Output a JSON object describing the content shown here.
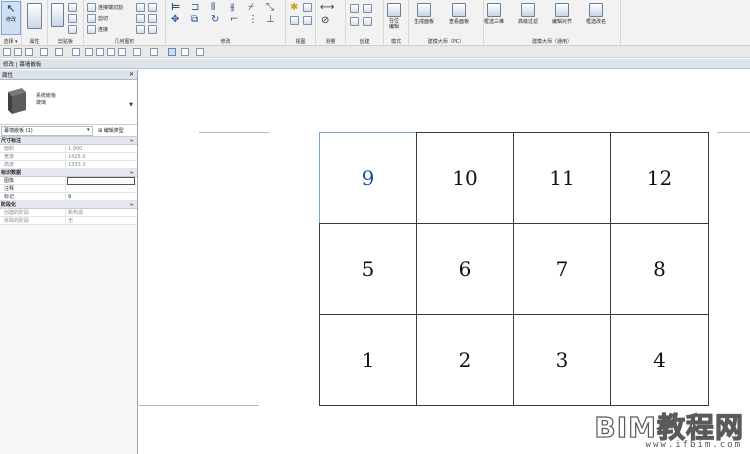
{
  "ribbon": {
    "modify_label": "修改",
    "select_label": "选择 ▾",
    "panels": {
      "properties": "属性",
      "clipboard": "剪贴板",
      "geometry": "几何图形",
      "modify": "修改",
      "view": "视图",
      "measure": "测量",
      "create": "创建",
      "mode": "模式",
      "model_pc": "建模大师（PC）",
      "model_general": "建模大师（通用）"
    },
    "geometry_items": [
      "连接端切割",
      "剪切",
      "连接"
    ],
    "buttons": {
      "in_place_edit": "在位\n编辑",
      "generate_panel": "生成面板",
      "view_panel": "查看面板",
      "filter_3d": "框选三维",
      "advanced_filter": "高级过滤",
      "unpin_all": "编辑对齐",
      "filter_revise": "框选改名"
    }
  },
  "context_bar": {
    "text": "修改 | 幕墙嵌板"
  },
  "properties": {
    "title": "属性",
    "close_glyph": "✕",
    "type_family": "系统嵌板",
    "type_name": "玻璃",
    "instance_selector": "幕墙嵌板 (1)",
    "edit_type": "编辑类型",
    "groups": [
      {
        "name": "尺寸标注",
        "rows": [
          {
            "key": "面积",
            "value": "1.900",
            "dim": true
          },
          {
            "key": "宽度",
            "value": "1425.0",
            "dim": true
          },
          {
            "key": "高度",
            "value": "1333.3",
            "dim": true
          }
        ]
      },
      {
        "name": "标识数据",
        "rows": [
          {
            "key": "图像",
            "value": "",
            "dim": false
          },
          {
            "key": "注释",
            "value": "",
            "dim": false
          },
          {
            "key": "标记",
            "value": "9",
            "dim": false
          }
        ]
      },
      {
        "name": "阶段化",
        "rows": [
          {
            "key": "创建的阶段",
            "value": "新构造",
            "dim": true
          },
          {
            "key": "拆除的阶段",
            "value": "无",
            "dim": true
          }
        ]
      }
    ]
  },
  "panels_grid": {
    "rows": [
      [
        "9",
        "10",
        "11",
        "12"
      ],
      [
        "5",
        "6",
        "7",
        "8"
      ],
      [
        "1",
        "2",
        "3",
        "4"
      ]
    ],
    "active_tag": "9"
  },
  "watermark": {
    "title": "BIM教程网",
    "url": "www.ifbim.com"
  },
  "colors": {
    "active_tag": "#1d4c9e",
    "ribbon_bg": "#f2f2f2",
    "selection_blue": "#cfe0f5"
  }
}
